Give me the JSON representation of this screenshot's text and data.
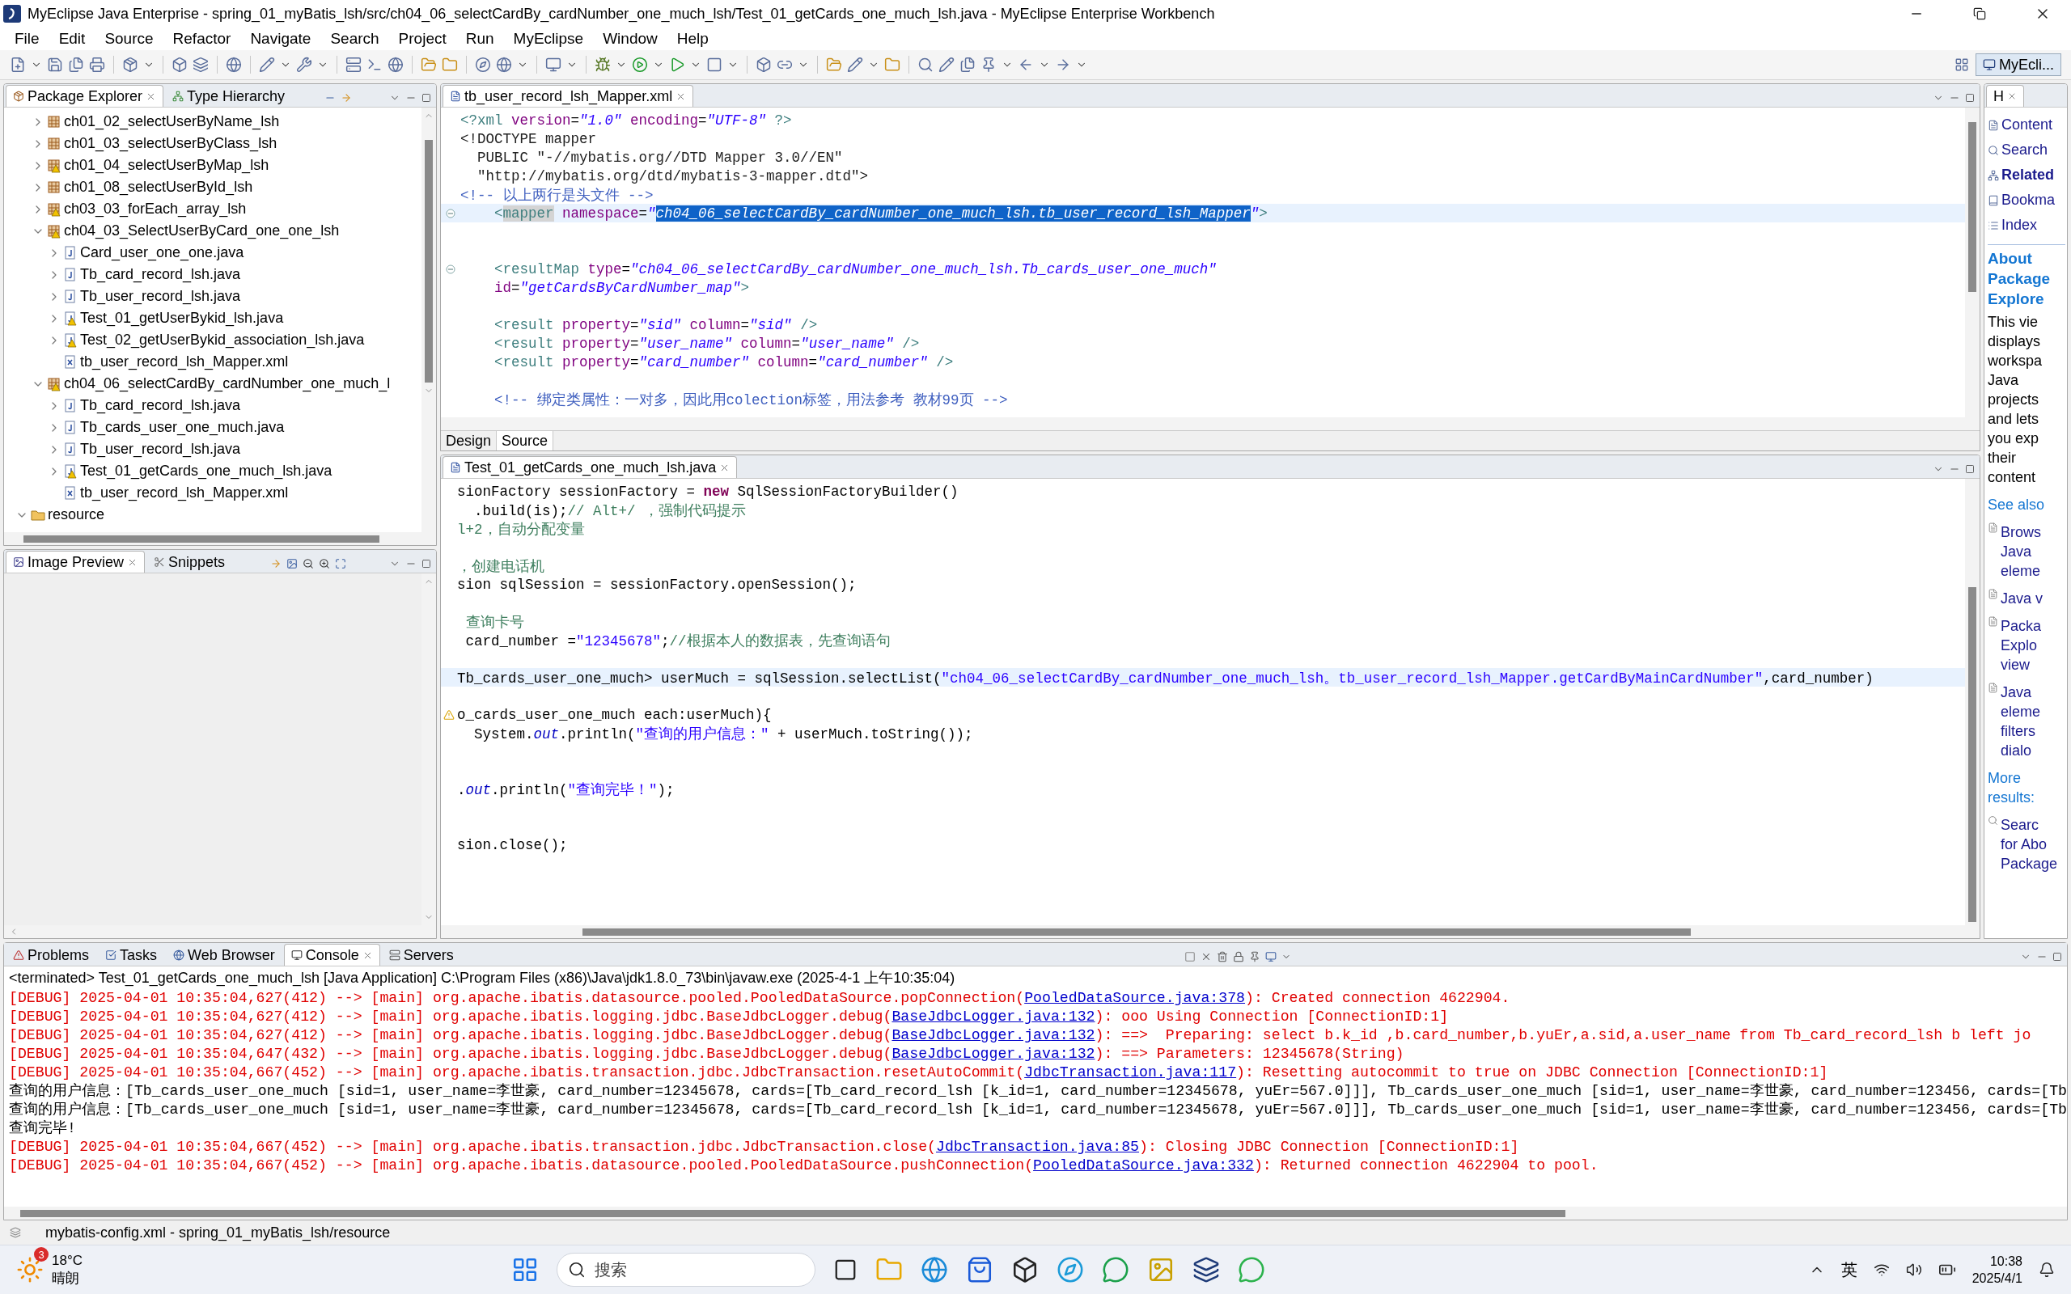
{
  "window": {
    "title": "MyEclipse Java Enterprise - spring_01_myBatis_lsh/src/ch04_06_selectCardBy_cardNumber_one_much_lsh/Test_01_getCards_one_much_lsh.java - MyEclipse Enterprise Workbench"
  },
  "menu": [
    "File",
    "Edit",
    "Source",
    "Refactor",
    "Navigate",
    "Search",
    "Project",
    "Run",
    "MyEclipse",
    "Window",
    "Help"
  ],
  "perspective": {
    "label": "MyEcli..."
  },
  "package_explorer": {
    "tabs": [
      {
        "label": "Package Explorer",
        "selected": true
      },
      {
        "label": "Type Hierarchy",
        "selected": false
      }
    ],
    "tree": [
      {
        "kind": "hidden",
        "children": [
          {
            "kind": "package",
            "label": "ch01_02_selectUserByName_lsh",
            "expanded": false,
            "warning": false
          },
          {
            "kind": "package",
            "label": "ch01_03_selectUserByClass_lsh",
            "expanded": false,
            "warning": false
          },
          {
            "kind": "package",
            "label": "ch01_04_selectUserByMap_lsh",
            "expanded": false,
            "warning": true
          },
          {
            "kind": "package",
            "label": "ch01_08_selectUserById_lsh",
            "expanded": false,
            "warning": false
          },
          {
            "kind": "package",
            "label": "ch03_03_forEach_array_lsh",
            "expanded": false,
            "warning": true
          },
          {
            "kind": "package",
            "label": "ch04_03_SelectUserByCard_one_one_lsh",
            "expanded": true,
            "warning": true,
            "children": [
              {
                "kind": "java",
                "label": "Card_user_one_one.java",
                "expanded": false,
                "warning": false
              },
              {
                "kind": "java",
                "label": "Tb_card_record_lsh.java",
                "expanded": false,
                "warning": false
              },
              {
                "kind": "java",
                "label": "Tb_user_record_lsh.java",
                "expanded": false,
                "warning": false
              },
              {
                "kind": "java",
                "label": "Test_01_getUserBykid_lsh.java",
                "expanded": false,
                "warning": true
              },
              {
                "kind": "java",
                "label": "Test_02_getUserBykid_association_lsh.java",
                "expanded": false,
                "warning": true
              },
              {
                "kind": "xml",
                "label": "tb_user_record_lsh_Mapper.xml",
                "warning": false
              }
            ]
          },
          {
            "kind": "package",
            "label": "ch04_06_selectCardBy_cardNumber_one_much_l",
            "expanded": true,
            "warning": true,
            "children": [
              {
                "kind": "java",
                "label": "Tb_card_record_lsh.java",
                "expanded": false,
                "warning": false
              },
              {
                "kind": "java",
                "label": "Tb_cards_user_one_much.java",
                "expanded": false,
                "warning": false
              },
              {
                "kind": "java",
                "label": "Tb_user_record_lsh.java",
                "expanded": false,
                "warning": false
              },
              {
                "kind": "java",
                "label": "Test_01_getCards_one_much_lsh.java",
                "expanded": false,
                "warning": true
              },
              {
                "kind": "xml",
                "label": "tb_user_record_lsh_Mapper.xml",
                "warning": false
              }
            ]
          }
        ]
      },
      {
        "kind": "folder",
        "label": "resource",
        "expanded": true,
        "warning": false
      }
    ]
  },
  "image_preview": {
    "tabs": [
      {
        "label": "Image Preview",
        "selected": true
      },
      {
        "label": "Snippets",
        "selected": false
      }
    ]
  },
  "xml_editor": {
    "tab": "tb_user_record_lsh_Mapper.xml",
    "lines": [
      {
        "current": false,
        "fold": false,
        "tokens": [
          {
            "kind": "tag",
            "text": "<?xml "
          },
          {
            "kind": "attr",
            "text": "version"
          },
          {
            "kind": "plain",
            "text": "="
          },
          {
            "kind": "val",
            "text": "\"1.0\""
          },
          {
            "kind": "attr",
            "text": " encoding"
          },
          {
            "kind": "plain",
            "text": "="
          },
          {
            "kind": "val",
            "text": "\"UTF-8\""
          },
          {
            "kind": "tag",
            "text": " ?>"
          }
        ]
      },
      {
        "current": false,
        "fold": false,
        "tokens": [
          {
            "kind": "doc",
            "text": "<!DOCTYPE mapper"
          }
        ]
      },
      {
        "current": false,
        "fold": false,
        "tokens": [
          {
            "kind": "doc",
            "text": "  PUBLIC \"-//mybatis.org//DTD Mapper 3.0//EN\""
          }
        ]
      },
      {
        "current": false,
        "fold": false,
        "tokens": [
          {
            "kind": "doc",
            "text": "  \"http://mybatis.org/dtd/mybatis-3-mapper.dtd\">"
          }
        ]
      },
      {
        "current": false,
        "fold": false,
        "tokens": [
          {
            "kind": "comment",
            "text": "<!-- 以上两行是头文件 -->"
          }
        ]
      },
      {
        "current": true,
        "fold": true,
        "tokens": [
          {
            "kind": "tag",
            "text": "    <"
          },
          {
            "kind": "occurrence",
            "text": "mapper"
          },
          {
            "kind": "attr",
            "text": " namespace"
          },
          {
            "kind": "plain",
            "text": "="
          },
          {
            "kind": "val",
            "text": "\""
          },
          {
            "kind": "selection",
            "text": "ch04_06_selectCardBy_cardNumber_one_much_lsh.tb_user_record_lsh_Mapper"
          },
          {
            "kind": "val",
            "text": "\""
          },
          {
            "kind": "tag",
            "text": ">"
          }
        ]
      },
      {
        "current": false,
        "fold": false
      },
      {
        "current": false,
        "fold": false
      },
      {
        "current": false,
        "fold": true,
        "tokens": [
          {
            "kind": "tag",
            "text": "    <resultMap "
          },
          {
            "kind": "attr",
            "text": "type"
          },
          {
            "kind": "plain",
            "text": "="
          },
          {
            "kind": "val",
            "text": "\"ch04_06_selectCardBy_cardNumber_one_much_lsh.Tb_cards_user_one_much\""
          }
        ]
      },
      {
        "current": false,
        "fold": false,
        "tokens": [
          {
            "kind": "attr",
            "text": "    id"
          },
          {
            "kind": "plain",
            "text": "="
          },
          {
            "kind": "val",
            "text": "\"getCardsByCardNumber_map\""
          },
          {
            "kind": "tag",
            "text": ">"
          }
        ]
      },
      {
        "current": false,
        "fold": false
      },
      {
        "current": false,
        "fold": false,
        "tokens": [
          {
            "kind": "tag",
            "text": "    <result "
          },
          {
            "kind": "attr",
            "text": "property"
          },
          {
            "kind": "plain",
            "text": "="
          },
          {
            "kind": "val",
            "text": "\"sid\""
          },
          {
            "kind": "attr",
            "text": " column"
          },
          {
            "kind": "plain",
            "text": "="
          },
          {
            "kind": "val",
            "text": "\"sid\""
          },
          {
            "kind": "tag",
            "text": " />"
          }
        ]
      },
      {
        "current": false,
        "fold": false,
        "tokens": [
          {
            "kind": "tag",
            "text": "    <result "
          },
          {
            "kind": "attr",
            "text": "property"
          },
          {
            "kind": "plain",
            "text": "="
          },
          {
            "kind": "val",
            "text": "\"user_name\""
          },
          {
            "kind": "attr",
            "text": " column"
          },
          {
            "kind": "plain",
            "text": "="
          },
          {
            "kind": "val",
            "text": "\"user_name\""
          },
          {
            "kind": "tag",
            "text": " />"
          }
        ]
      },
      {
        "current": false,
        "fold": false,
        "tokens": [
          {
            "kind": "tag",
            "text": "    <result "
          },
          {
            "kind": "attr",
            "text": "property"
          },
          {
            "kind": "plain",
            "text": "="
          },
          {
            "kind": "val",
            "text": "\"card_number\""
          },
          {
            "kind": "attr",
            "text": " column"
          },
          {
            "kind": "plain",
            "text": "="
          },
          {
            "kind": "val",
            "text": "\"card_number\""
          },
          {
            "kind": "tag",
            "text": " />"
          }
        ]
      },
      {
        "current": false,
        "fold": false
      },
      {
        "current": false,
        "fold": false,
        "tokens": [
          {
            "kind": "comment",
            "text": "    <!-- 绑定类属性：一对多，因此用colection标签，用法参考 教材99页 -->"
          }
        ]
      }
    ],
    "bottom_tabs": [
      {
        "label": "Design",
        "selected": false
      },
      {
        "label": "Source",
        "selected": true
      }
    ]
  },
  "java_editor": {
    "tab": "Test_01_getCards_one_much_lsh.java",
    "lines": [
      {
        "current": false,
        "warning": false,
        "tokens": [
          {
            "kind": "plain",
            "text": "sionFactory sessionFactory = "
          },
          {
            "kind": "kw",
            "text": "new"
          },
          {
            "kind": "plain",
            "text": " SqlSessionFactoryBuilder()"
          }
        ]
      },
      {
        "current": false,
        "warning": false,
        "tokens": [
          {
            "kind": "plain",
            "text": "  .build(is);"
          },
          {
            "kind": "comment",
            "text": "// Alt+/ ，强制代码提示"
          }
        ]
      },
      {
        "current": false,
        "warning": false,
        "tokens": [
          {
            "kind": "comment",
            "text": "l+2，自动分配变量"
          }
        ]
      },
      {
        "current": false,
        "warning": false
      },
      {
        "current": false,
        "warning": false,
        "tokens": [
          {
            "kind": "comment",
            "text": "，创建电话机"
          }
        ]
      },
      {
        "current": false,
        "warning": false,
        "tokens": [
          {
            "kind": "plain",
            "text": "sion sqlSession = sessionFactory.openSession();"
          }
        ]
      },
      {
        "current": false,
        "warning": false
      },
      {
        "current": false,
        "warning": false,
        "tokens": [
          {
            "kind": "comment",
            "text": " 查询卡号"
          }
        ]
      },
      {
        "current": false,
        "warning": false,
        "tokens": [
          {
            "kind": "plain",
            "text": " card_number ="
          },
          {
            "kind": "str",
            "text": "\"12345678\""
          },
          {
            "kind": "plain",
            "text": ";"
          },
          {
            "kind": "comment",
            "text": "//根据本人的数据表，先查询语句"
          }
        ]
      },
      {
        "current": false,
        "warning": false
      },
      {
        "current": true,
        "warning": false,
        "tokens": [
          {
            "kind": "plain",
            "text": "Tb_cards_user_one_much> userMuch = sqlSession.selectList("
          },
          {
            "kind": "str",
            "text": "\"ch04_06_selectCardBy_cardNumber_one_much_lsh。tb_user_record_lsh_Mapper.getCardByMainCardNumber\""
          },
          {
            "kind": "plain",
            "text": ",card_number)"
          }
        ]
      },
      {
        "current": false,
        "warning": false
      },
      {
        "current": false,
        "warning": true,
        "tokens": [
          {
            "kind": "plain",
            "text": "o_cards_user_one_much each:userMuch){"
          }
        ]
      },
      {
        "current": false,
        "warning": false,
        "tokens": [
          {
            "kind": "plain",
            "text": "  System."
          },
          {
            "kind": "field",
            "text": "out"
          },
          {
            "kind": "plain",
            "text": ".println("
          },
          {
            "kind": "str",
            "text": "\"查询的用户信息：\""
          },
          {
            "kind": "plain",
            "text": " + userMuch.toString());"
          }
        ]
      },
      {
        "current": false,
        "warning": false
      },
      {
        "current": false,
        "warning": false
      },
      {
        "current": false,
        "warning": false,
        "tokens": [
          {
            "kind": "plain",
            "text": "."
          },
          {
            "kind": "field",
            "text": "out"
          },
          {
            "kind": "plain",
            "text": ".println("
          },
          {
            "kind": "str",
            "text": "\"查询完毕！\""
          },
          {
            "kind": "plain",
            "text": ");"
          }
        ]
      },
      {
        "current": false,
        "warning": false
      },
      {
        "current": false,
        "warning": false
      },
      {
        "current": false,
        "warning": false,
        "tokens": [
          {
            "kind": "plain",
            "text": "sion.close();"
          }
        ]
      }
    ]
  },
  "help": {
    "tab": "H",
    "links": [
      {
        "label": "Content",
        "selected": false
      },
      {
        "label": "Search",
        "selected": false
      },
      {
        "label": "Related",
        "selected": true
      },
      {
        "label": "Bookma",
        "selected": false
      },
      {
        "label": "Index",
        "selected": false
      }
    ],
    "heading_lines": [
      "About",
      "Package",
      "Explore"
    ],
    "body_lines": [
      "This vie",
      "displays",
      "workspa",
      "Java",
      "projects",
      "and lets",
      "you exp",
      "their",
      "content"
    ],
    "see_also": "See also",
    "topics": [
      {
        "lines": [
          "Brows",
          "Java",
          "eleme"
        ]
      },
      {
        "lines": [
          "Java v"
        ]
      },
      {
        "lines": [
          "Packa",
          "Explo",
          "view"
        ]
      },
      {
        "lines": [
          "Java",
          "eleme",
          "filters",
          "dialo"
        ]
      }
    ],
    "more_lines": [
      "More",
      "results:"
    ],
    "search_lines": [
      "Searc",
      "for Abo",
      "Package"
    ]
  },
  "console": {
    "tabs": [
      {
        "label": "Problems",
        "selected": false
      },
      {
        "label": "Tasks",
        "selected": false
      },
      {
        "label": "Web Browser",
        "selected": false
      },
      {
        "label": "Console",
        "selected": true
      },
      {
        "label": "Servers",
        "selected": false
      }
    ],
    "header": "<terminated> Test_01_getCards_one_much_lsh [Java Application] C:\\Program Files (x86)\\Java\\jdk1.8.0_73\\bin\\javaw.exe (2025-4-1 上午10:35:04)",
    "lines": [
      {
        "kind": "debug",
        "before": "[DEBUG] 2025-04-01 10:35:04,627(412) --> [main] org.apache.ibatis.datasource.pooled.PooledDataSource.popConnection(",
        "link": "PooledDataSource.java:378",
        "after": "): Created connection 4622904."
      },
      {
        "kind": "debug",
        "before": "[DEBUG] 2025-04-01 10:35:04,627(412) --> [main] org.apache.ibatis.logging.jdbc.BaseJdbcLogger.debug(",
        "link": "BaseJdbcLogger.java:132",
        "after": "): ooo Using Connection [ConnectionID:1]"
      },
      {
        "kind": "debug",
        "before": "[DEBUG] 2025-04-01 10:35:04,627(412) --> [main] org.apache.ibatis.logging.jdbc.BaseJdbcLogger.debug(",
        "link": "BaseJdbcLogger.java:132",
        "after": "): ==>  Preparing: select b.k_id ,b.card_number,b.yuEr,a.sid,a.user_name from Tb_card_record_lsh b left jo"
      },
      {
        "kind": "debug",
        "before": "[DEBUG] 2025-04-01 10:35:04,647(432) --> [main] org.apache.ibatis.logging.jdbc.BaseJdbcLogger.debug(",
        "link": "BaseJdbcLogger.java:132",
        "after": "): ==> Parameters: 12345678(String)"
      },
      {
        "kind": "debug",
        "before": "[DEBUG] 2025-04-01 10:35:04,667(452) --> [main] org.apache.ibatis.transaction.jdbc.JdbcTransaction.resetAutoCommit(",
        "link": "JdbcTransaction.java:117",
        "after": "): Resetting autocommit to true on JDBC Connection [ConnectionID:1]"
      },
      {
        "kind": "output",
        "before": "查询的用户信息：[Tb_cards_user_one_much [sid=1, user_name=李世豪, card_number=12345678, cards=[Tb_card_record_lsh [k_id=1, card_number=12345678, yuEr=567.0]]], Tb_cards_user_one_much [sid=1, user_name=李世豪, card_number=123456, cards=[Tb"
      },
      {
        "kind": "output",
        "before": "查询的用户信息：[Tb_cards_user_one_much [sid=1, user_name=李世豪, card_number=12345678, cards=[Tb_card_record_lsh [k_id=1, card_number=12345678, yuEr=567.0]]], Tb_cards_user_one_much [sid=1, user_name=李世豪, card_number=123456, cards=[Tb"
      },
      {
        "kind": "output",
        "before": "查询完毕!"
      },
      {
        "kind": "debug",
        "before": "[DEBUG] 2025-04-01 10:35:04,667(452) --> [main] org.apache.ibatis.transaction.jdbc.JdbcTransaction.close(",
        "link": "JdbcTransaction.java:85",
        "after": "): Closing JDBC Connection [ConnectionID:1]"
      },
      {
        "kind": "debug",
        "before": "[DEBUG] 2025-04-01 10:35:04,667(452) --> [main] org.apache.ibatis.datasource.pooled.PooledDataSource.pushConnection(",
        "link": "PooledDataSource.java:332",
        "after": "): Returned connection 4622904 to pool."
      }
    ]
  },
  "status_bar": {
    "text": "mybatis-config.xml - spring_01_myBatis_lsh/resource"
  },
  "taskbar": {
    "weather": {
      "badge": "3",
      "temp": "18°C",
      "condition": "晴朗"
    },
    "search": {
      "placeholder": "搜索"
    },
    "ime": "英",
    "time": "10:38",
    "date": "2025/4/1"
  }
}
